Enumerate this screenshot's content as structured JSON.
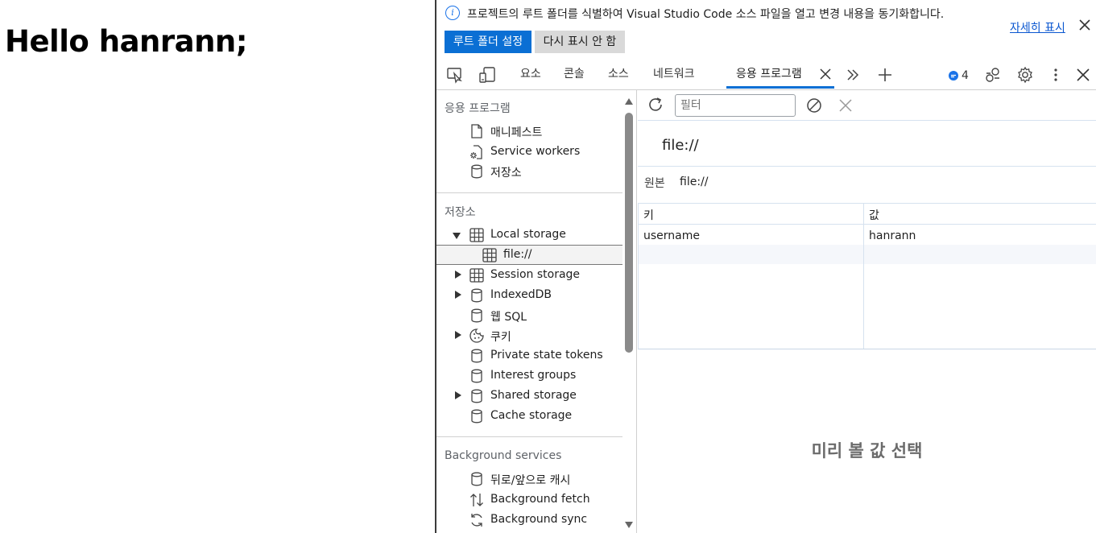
{
  "page": {
    "heading": "Hello hanrann;"
  },
  "infobar": {
    "message": "프로젝트의 루트 폴더를 식별하여 Visual Studio Code 소스 파일을 열고 변경 내용을 동기화합니다.",
    "set_root_button": "루트 폴더 설정",
    "dont_show_button": "다시 표시 안 함",
    "learn_more_link": "자세히 표시"
  },
  "toolbar": {
    "tabs": [
      {
        "label": "요소"
      },
      {
        "label": "콘솔"
      },
      {
        "label": "소스"
      },
      {
        "label": "네트워크"
      },
      {
        "label": "응용 프로그램"
      }
    ],
    "active_tab_index": 4,
    "issues_count": "4",
    "accent_color": "#0b6fd4"
  },
  "sidebar": {
    "section_application": "응용 프로그램",
    "application_items": [
      {
        "label": "매니페스트",
        "icon": "document-icon"
      },
      {
        "label": "Service workers",
        "icon": "gear-document-icon"
      },
      {
        "label": "저장소",
        "icon": "database-icon"
      }
    ],
    "section_storage": "저장소",
    "storage_items": [
      {
        "label": "Local storage",
        "icon": "table-icon",
        "expanded": true
      },
      {
        "label": "file://",
        "icon": "table-icon",
        "selected": true
      },
      {
        "label": "Session storage",
        "icon": "table-icon"
      },
      {
        "label": "IndexedDB",
        "icon": "database-icon"
      },
      {
        "label": "웹 SQL",
        "icon": "database-icon"
      },
      {
        "label": "쿠키",
        "icon": "cookie-icon"
      },
      {
        "label": "Private state tokens",
        "icon": "database-icon"
      },
      {
        "label": "Interest groups",
        "icon": "database-icon"
      },
      {
        "label": "Shared storage",
        "icon": "database-icon"
      },
      {
        "label": "Cache storage",
        "icon": "database-icon"
      }
    ],
    "section_background": "Background services",
    "background_items": [
      {
        "label": "뒤로/앞으로 캐시",
        "icon": "database-icon"
      },
      {
        "label": "Background fetch",
        "icon": "arrows-updown-icon"
      },
      {
        "label": "Background sync",
        "icon": "sync-icon"
      }
    ]
  },
  "main": {
    "filter_placeholder": "필터",
    "origin_title": "file://",
    "origin_label": "원본",
    "origin_value": "file://",
    "columns": [
      "키",
      "값"
    ],
    "rows": [
      {
        "key": "username",
        "value": "hanrann"
      }
    ],
    "preview_message": "미리 볼 값 선택"
  }
}
